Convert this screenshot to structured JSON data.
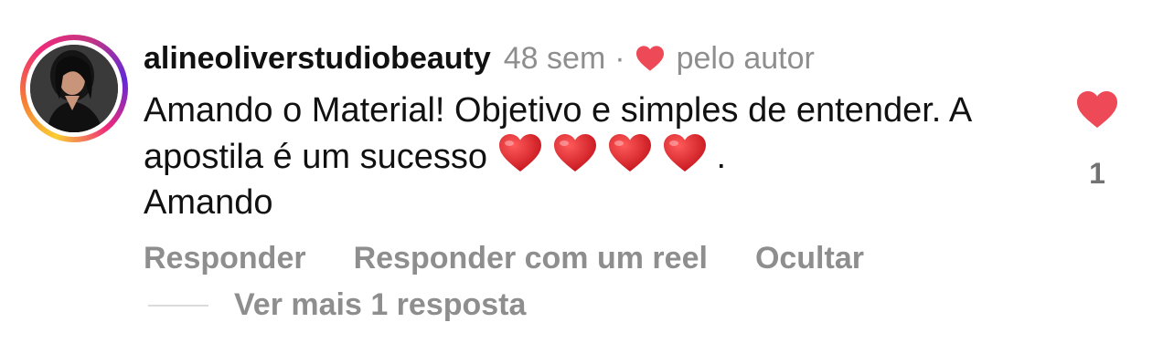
{
  "comment": {
    "username": "alineoliverstudiobeauty",
    "time": "48 sem",
    "separator": "·",
    "liked_by_author": "pelo autor",
    "text_part1": "Amando o Material! Objetivo e simples de entender. A apostila é um sucesso",
    "text_part2": ".",
    "text_part3": "Amando",
    "emoji_heart_count": 4,
    "like_count": "1"
  },
  "actions": {
    "reply": "Responder",
    "reply_with_reel": "Responder com um reel",
    "hide": "Ocultar"
  },
  "replies": {
    "view_more": "Ver mais 1 resposta"
  },
  "colors": {
    "heart_red": "#ed4956",
    "meta_gray": "#8e8e8e",
    "divider": "#dbdbdb"
  },
  "icons": {
    "author_like": "heart-icon",
    "like_button": "heart-filled-icon"
  }
}
